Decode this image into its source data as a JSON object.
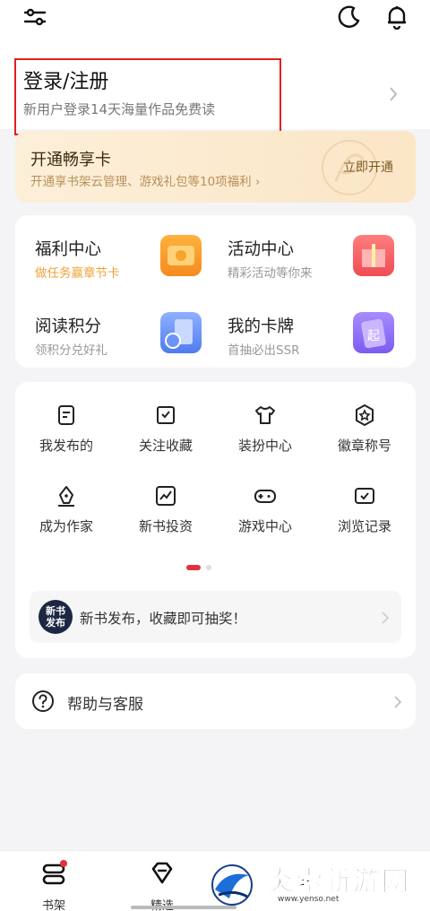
{
  "topbar": {
    "settings_icon": "sliders-icon",
    "theme_icon": "moon-icon",
    "notify_icon": "bell-icon"
  },
  "login": {
    "title": "登录/注册",
    "subtitle": "新用户登录14天海量作品免费读"
  },
  "vip": {
    "title": "开通畅享卡",
    "subtitle": "开通享书架云管理、游戏礼包等10项福利 ›",
    "button": "立即开通"
  },
  "features": [
    {
      "title": "福利中心",
      "subtitle": "做任务赢章节卡",
      "icon": "coin-wallet-icon"
    },
    {
      "title": "活动中心",
      "subtitle": "精彩活动等你来",
      "icon": "gift-box-icon"
    },
    {
      "title": "阅读积分",
      "subtitle": "领积分兑好礼",
      "icon": "book-coin-icon"
    },
    {
      "title": "我的卡牌",
      "subtitle": "首抽必出SSR",
      "icon": "card-deck-icon"
    }
  ],
  "grid": [
    {
      "label": "我发布的",
      "icon": "document-icon"
    },
    {
      "label": "关注收藏",
      "icon": "bookmark-check-icon"
    },
    {
      "label": "装扮中心",
      "icon": "shirt-icon"
    },
    {
      "label": "徽章称号",
      "icon": "badge-star-icon"
    },
    {
      "label": "成为作家",
      "icon": "pen-nib-icon"
    },
    {
      "label": "新书投资",
      "icon": "chart-up-icon"
    },
    {
      "label": "游戏中心",
      "icon": "gamepad-icon"
    },
    {
      "label": "浏览记录",
      "icon": "history-icon"
    }
  ],
  "notice": {
    "badge": "新书发布",
    "text": "新书发布，收藏即可抽奖！"
  },
  "help": {
    "label": "帮助与客服",
    "icon": "question-circle-icon"
  },
  "tabs": [
    {
      "label": "书架",
      "icon": "bookshelf-icon"
    },
    {
      "label": "精选",
      "icon": "diamond-icon"
    }
  ],
  "watermark": {
    "text": "炎索新游网",
    "url": "www.yenso.net"
  },
  "colors": {
    "accent": "#e0323d",
    "login_highlight": "#e0201e",
    "vip_bg": "#fbe6c6",
    "welfare_orange": "#f0a33a"
  }
}
